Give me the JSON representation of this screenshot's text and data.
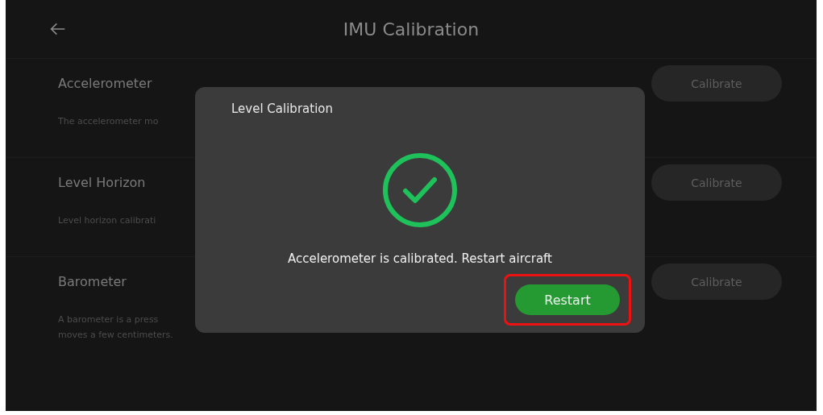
{
  "header": {
    "title": "IMU Calibration"
  },
  "sections": [
    {
      "title": "Accelerometer",
      "description": [
        "The accelerometer mo"
      ],
      "button": "Calibrate"
    },
    {
      "title": "Level Horizon",
      "description": [
        "Level horizon calibrati"
      ],
      "button": "Calibrate"
    },
    {
      "title": "Barometer",
      "description": [
        "A barometer is a press",
        "moves a few centimeters."
      ],
      "button": "Calibrate"
    }
  ],
  "dialog": {
    "title": "Level Calibration",
    "message": "Accelerometer is calibrated. Restart aircraft",
    "button": {
      "label": "Restart",
      "highlighted": true
    }
  }
}
